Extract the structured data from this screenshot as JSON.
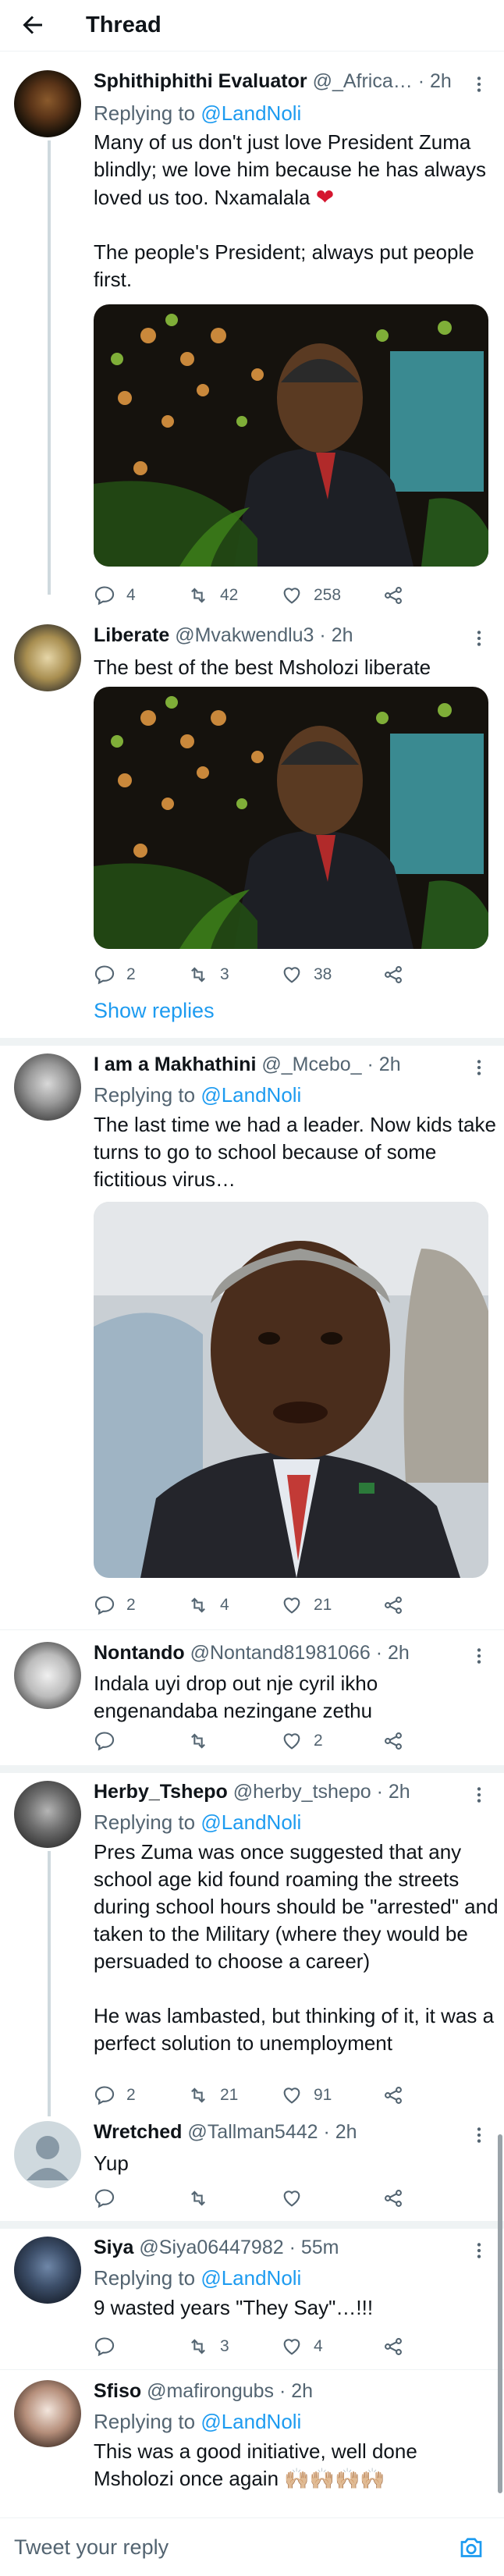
{
  "header": {
    "title": "Thread",
    "back_icon": "back-arrow-icon"
  },
  "colors": {
    "accent": "#1d9bf0",
    "text": "#0f1419",
    "muted": "#536471",
    "divider": "#eff3f4"
  },
  "tweets": [
    {
      "name": "Sphithiphithi Evaluator",
      "handle": "@_Africa…",
      "time": "· 2h",
      "replying_label": "Replying to",
      "replying_to": "@LandNoli",
      "text_1": "Many of us don't just love President Zuma blindly; we love him because he has always loved us too. Nxamalala",
      "emoji": "❤",
      "text_2": "The people's President; always put people first.",
      "media": "photo-zuma-microphone",
      "replies": "4",
      "retweets": "42",
      "likes": "258"
    },
    {
      "name": "Liberate",
      "handle": "@Mvakwendlu3",
      "time": "· 2h",
      "text_1": "The best of the best Msholozi liberate",
      "media": "photo-zuma-microphone",
      "replies": "2",
      "retweets": "3",
      "likes": "38",
      "show_replies": "Show replies"
    },
    {
      "name": "I am a Makhathini",
      "handle": "@_Mcebo_",
      "time": "· 2h",
      "replying_label": "Replying to",
      "replying_to": "@LandNoli",
      "text_1": "The last time we had a leader. Now kids take turns to go to school because of some fictitious virus…",
      "media": "photo-ramaphosa-airplane",
      "replies": "2",
      "retweets": "4",
      "likes": "21"
    },
    {
      "name": "Nontando",
      "handle": "@Nontand81981066",
      "time": "· 2h",
      "text_1": "Indala uyi drop out nje cyril ikho engenandaba nezingane zethu",
      "replies": "",
      "retweets": "",
      "likes": "2"
    },
    {
      "name": "Herby_Tshepo",
      "handle": "@herby_tshepo",
      "time": "· 2h",
      "replying_label": "Replying to",
      "replying_to": "@LandNoli",
      "text_1": "Pres Zuma was once suggested that any school age kid found roaming the streets during school hours should be \"arrested\" and taken to the Military (where they would be persuaded to choose a career)",
      "text_2": "He was lambasted, but thinking of it, it was a perfect solution to unemployment",
      "replies": "2",
      "retweets": "21",
      "likes": "91"
    },
    {
      "name": "Wretched",
      "handle": "@Tallman5442",
      "time": "· 2h",
      "text_1": "Yup",
      "replies": "",
      "retweets": "",
      "likes": ""
    },
    {
      "name": "Siya",
      "handle": "@Siya06447982",
      "time": "· 55m",
      "replying_label": "Replying to",
      "replying_to": "@LandNoli",
      "text_1": "9 wasted years \"They Say\"…!!!",
      "replies": "",
      "retweets": "3",
      "likes": "4"
    },
    {
      "name": "Sfiso",
      "handle": "@mafirongubs",
      "time": "· 2h",
      "replying_label": "Replying to",
      "replying_to": "@LandNoli",
      "text_1": "This was a good initiative, well done Msholozi once again",
      "emoji": "🙌🏼🙌🏼🙌🏼🙌🏼"
    }
  ],
  "composer": {
    "placeholder": "Tweet your reply",
    "camera_icon": "camera-icon"
  }
}
